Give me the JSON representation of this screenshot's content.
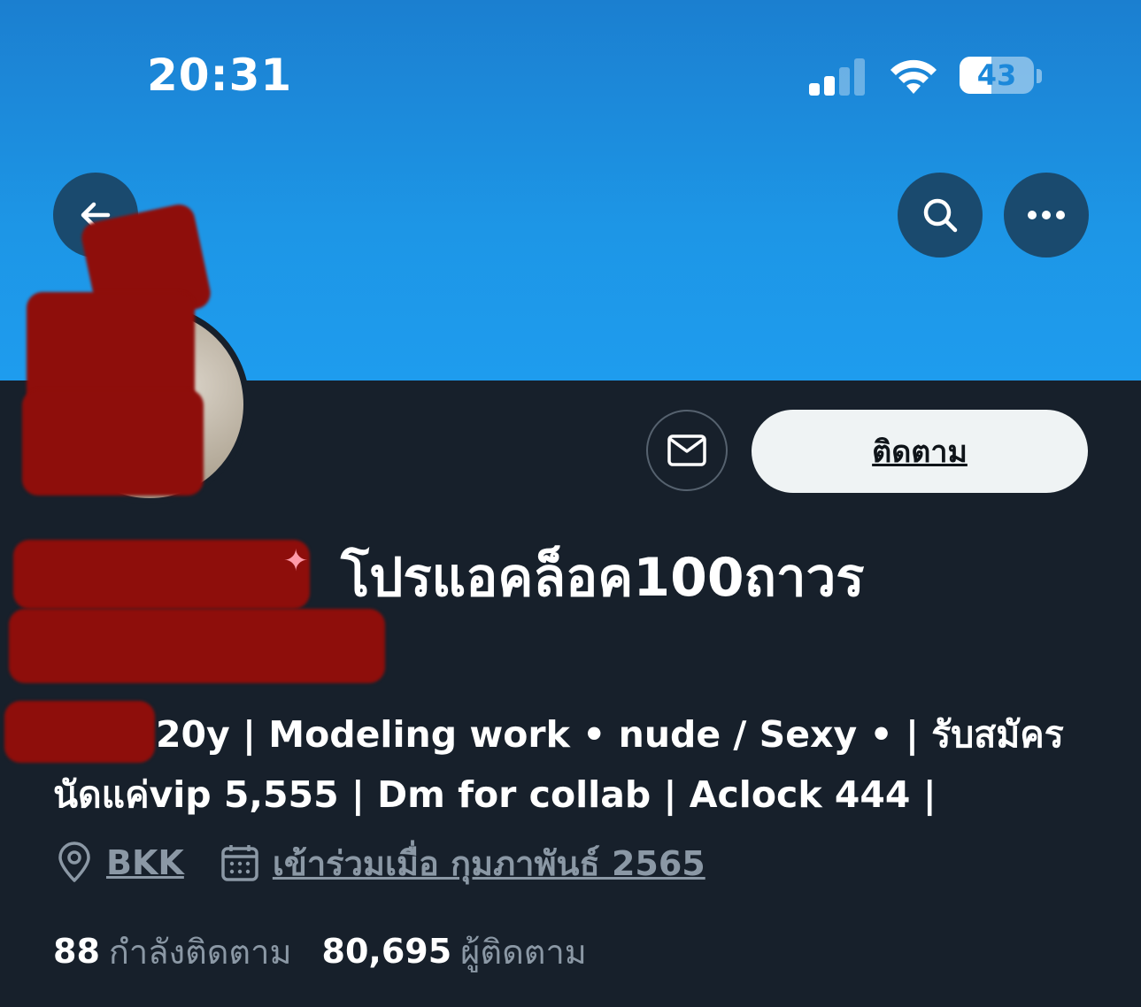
{
  "status_bar": {
    "time": "20:31",
    "battery": "43",
    "icons": [
      "signal-icon",
      "wifi-icon",
      "battery-icon"
    ]
  },
  "header": {
    "back_icon": "arrow-left-icon",
    "search_icon": "search-icon",
    "more_icon": "more-horizontal-icon"
  },
  "profile": {
    "display_name": "โปรแอคล็อค100ถาวร",
    "follow_label": "ติดตาม",
    "message_icon": "mail-icon",
    "bio_line1": "20y | Modeling work • nude / Sexy • | รับสมัคร",
    "bio_line2": "นัดแค่vip 5,555 | Dm for collab | Aclock 444 |",
    "location": "BKK",
    "joined": "เข้าร่วมเมื่อ กุมภาพันธ์ 2565",
    "following_count": "88",
    "following_label": "กำลังติดตาม",
    "followers_count": "80,695",
    "followers_label": "ผู้ติดตาม"
  },
  "colors": {
    "banner": "#1d96e6",
    "background": "#17202b",
    "muted_text": "#8b98a5",
    "follow_button_bg": "#eff3f4",
    "redaction": "#8e0e0b"
  }
}
